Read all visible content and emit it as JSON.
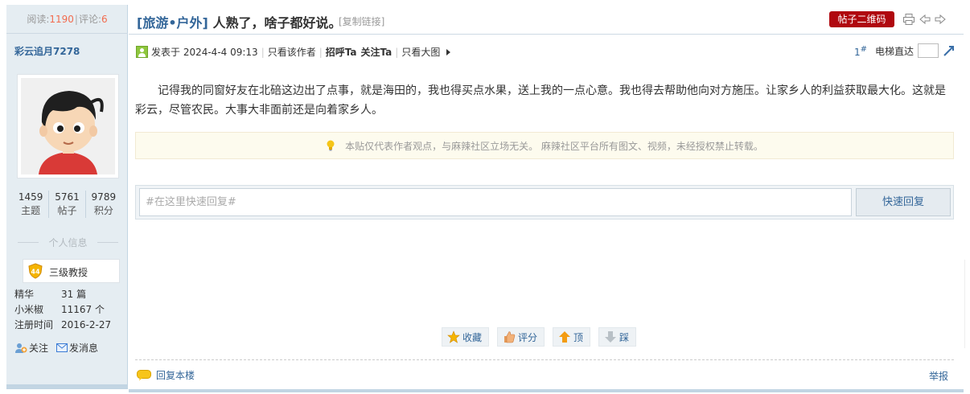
{
  "stats": {
    "views_label": "阅读:",
    "views": "1190",
    "sep": "|",
    "comments_label": "评论:",
    "comments": "6"
  },
  "thread": {
    "category": "[旅游•户外]",
    "title": "人熟了，啥子都好说。",
    "copy_link": "[复制链接]",
    "qr_button": "帖子二维码"
  },
  "author": {
    "name": "彩云追月7278",
    "stats": [
      {
        "value": "1459",
        "label": "主题"
      },
      {
        "value": "5761",
        "label": "帖子"
      },
      {
        "value": "9789",
        "label": "积分"
      }
    ],
    "info_title": "个人信息",
    "rank_level": "44",
    "rank_name": "三级教授",
    "meta": [
      {
        "key": "精华",
        "value": "31 篇"
      },
      {
        "key": "小米椒",
        "value": "11167 个"
      },
      {
        "key": "注册时间",
        "value": "2016-2-27"
      }
    ],
    "follow": "关注",
    "message": "发消息"
  },
  "post": {
    "posted_at": "发表于 2024-4-4 09:13",
    "only_author": "只看该作者",
    "greet": "招呼Ta",
    "follow": "关注Ta",
    "big_image": "只看大图",
    "floor": "1",
    "floor_suffix": "#",
    "elevator": "电梯直达",
    "body": "记得我的同窗好友在北碚这边出了点事，就是海田的，我也得买点水果，送上我的一点心意。我也得去帮助他向对方施压。让家乡人的利益获取最大化。这就是彩云，尽管农民。大事大非面前还是向着家乡人。",
    "notice": "本贴仅代表作者观点，与麻辣社区立场无关。 麻辣社区平台所有图文、视频，未经授权禁止转载。"
  },
  "reply": {
    "placeholder": "#在这里快速回复#",
    "button": "快速回复"
  },
  "actions": {
    "favorite": "收藏",
    "rate": "评分",
    "up": "顶",
    "down": "踩"
  },
  "footer": {
    "reply_floor": "回复本楼",
    "report": "举报"
  },
  "colors": {
    "accent": "#336699",
    "qr_red": "#b0080f",
    "counter": "#f26c4f",
    "sidebar_bg": "#e5edf2"
  }
}
